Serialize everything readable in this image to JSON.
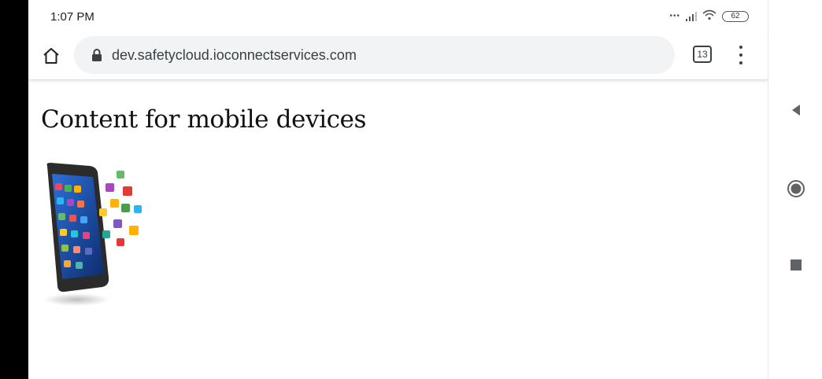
{
  "status_bar": {
    "time": "1:07 PM",
    "battery": "62",
    "icons": [
      "signal-icon",
      "wifi-icon",
      "battery-icon"
    ]
  },
  "toolbar": {
    "url": "dev.safetycloud.ioconnectservices.com",
    "tab_count": "13",
    "icons": [
      "home-icon",
      "lock-icon",
      "tab-switcher-icon",
      "more-vert-icon"
    ]
  },
  "page": {
    "heading": "Content for mobile devices",
    "image": "smartphone-with-app-icons"
  },
  "system_nav": {
    "icons": [
      "back-icon",
      "home-circle-icon",
      "recents-icon"
    ]
  },
  "colors": {
    "omnibox_bg": "#f1f3f4",
    "bezel": "#000000",
    "icon_gray": "#3c4043"
  }
}
